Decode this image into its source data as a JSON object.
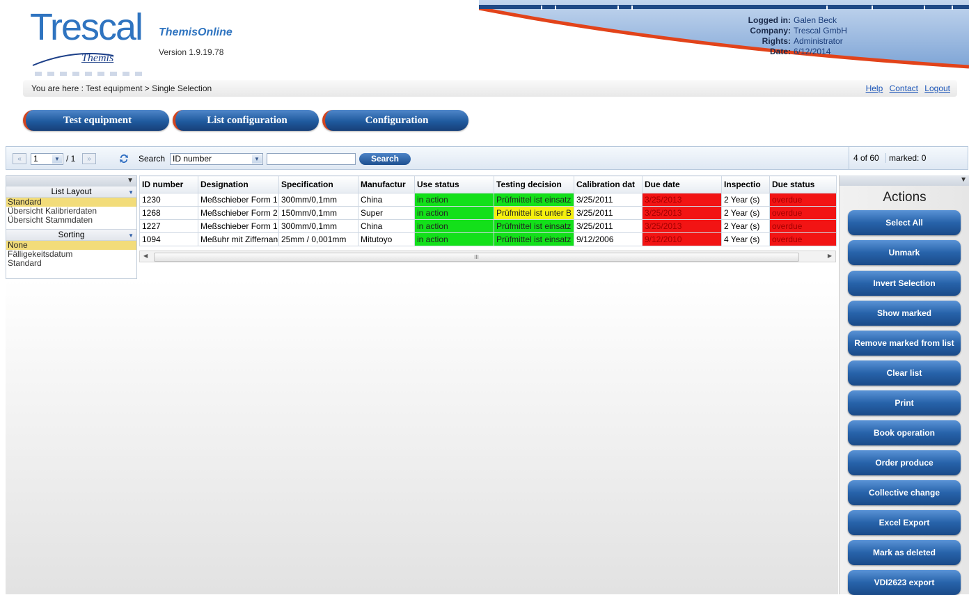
{
  "header": {
    "logo_text": "Trescal",
    "logo_sub": "Themis",
    "app_name": "ThemisOnline",
    "version": "Version 1.9.19.78",
    "login": [
      {
        "key": "Logged in:",
        "value": "Galen Beck"
      },
      {
        "key": "Company:",
        "value": "Trescal GmbH"
      },
      {
        "key": "Rights:",
        "value": "Administrator"
      },
      {
        "key": "Date:",
        "value": "6/12/2014"
      }
    ]
  },
  "breadcrumb": "You are here :  Test equipment > Single Selection",
  "toplinks": [
    "Help",
    "Contact",
    "Logout"
  ],
  "tabs": [
    "Test equipment",
    "List configuration",
    "Configuration"
  ],
  "toolbar": {
    "page_value": "1",
    "page_total": "/ 1",
    "search_label": "Search",
    "search_field": "ID number",
    "search_input": "",
    "search_button": "Search",
    "count": "4 of 60",
    "marked": "marked: 0"
  },
  "left_panel": {
    "list_layout_label": "List Layout",
    "list_layouts": [
      "Standard",
      "Übersicht Kalibrierdaten",
      "Übersicht Stammdaten"
    ],
    "sorting_label": "Sorting",
    "sortings": [
      "None",
      "Fälligekeitsdatum",
      "Standard"
    ]
  },
  "grid": {
    "columns": [
      "ID number",
      "Designation",
      "Specification",
      "Manufactur",
      "Use status",
      "Testing decision",
      "Calibration dat",
      "Due date",
      "Inspectio",
      "Due status"
    ],
    "rows": [
      [
        "1230",
        "Meßschieber Form 1",
        "300mm/0,1mm",
        "China",
        "in action",
        "Prüfmittel ist einsatz",
        "3/25/2011",
        "3/25/2013",
        "2 Year (s)",
        "overdue"
      ],
      [
        "1268",
        "Meßschieber Form 2",
        "150mm/0,1mm",
        "Super",
        "in action",
        "Prüfmittel ist unter B",
        "3/25/2011",
        "3/25/2013",
        "2 Year (s)",
        "overdue"
      ],
      [
        "1227",
        "Meßschieber Form 1",
        "300mm/0,1mm",
        "China",
        "in action",
        "Prüfmittel ist einsatz",
        "3/25/2011",
        "3/25/2013",
        "2 Year (s)",
        "overdue"
      ],
      [
        "1094",
        "Meßuhr mit Ziffernan",
        "25mm / 0,001mm",
        "Mitutoyo",
        "in action",
        "Prüfmittel ist einsatz",
        "9/12/2006",
        "9/12/2010",
        "4 Year (s)",
        "overdue"
      ]
    ]
  },
  "actions": {
    "title": "Actions",
    "buttons": [
      "Select All",
      "Unmark",
      "Invert Selection",
      "Show marked",
      "Remove marked from list",
      "Clear list",
      "Print",
      "Book operation",
      "Order produce",
      "Collective change",
      "Excel Export",
      "Mark as deleted",
      "VDI2623 export"
    ]
  },
  "colors": {
    "brand_blue": "#2f74c0",
    "status_green": "#13e01a",
    "status_yellow": "#f5f00e",
    "status_red": "#f21414"
  }
}
